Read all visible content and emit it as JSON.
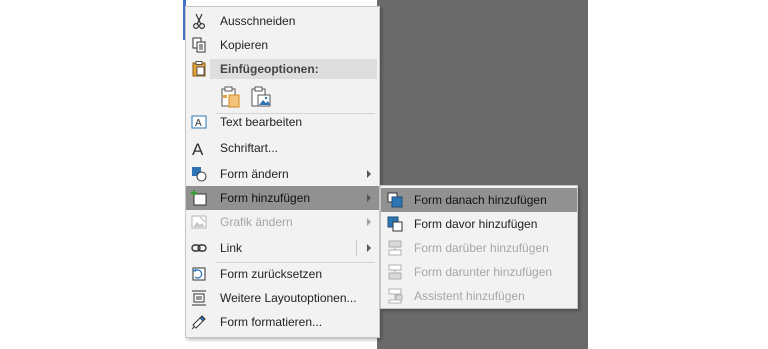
{
  "menu": {
    "cut": "Ausschneiden",
    "copy": "Kopieren",
    "paste_options": "Einfügeoptionen:",
    "edit_text": "Text bearbeiten",
    "font": "Schriftart...",
    "change_shape": "Form ändern",
    "add_shape": "Form hinzufügen",
    "change_graphic": "Grafik ändern",
    "link": "Link",
    "reset_shape": "Form zurücksetzen",
    "more_layout": "Weitere Layoutoptionen...",
    "format_shape": "Form formatieren..."
  },
  "submenu": {
    "add_after": "Form danach hinzufügen",
    "add_before": "Form davor hinzufügen",
    "add_above": "Form darüber hinzufügen",
    "add_below": "Form darunter hinzufügen",
    "add_assistant": "Assistent hinzufügen"
  },
  "colors": {
    "highlight": "#919191",
    "accent": "#2e75b6",
    "panel": "#6a6a6a"
  },
  "icons": [
    "scissors-icon",
    "copy-icon",
    "paste-icon",
    "paste-keep-formatting-icon",
    "paste-picture-icon",
    "textbox-icon",
    "font-icon",
    "change-shape-icon",
    "add-shape-icon",
    "change-graphic-icon",
    "link-icon",
    "reset-shape-icon",
    "layout-options-icon",
    "format-shape-icon",
    "add-after-icon",
    "add-before-icon",
    "add-above-icon",
    "add-below-icon",
    "add-assistant-icon"
  ]
}
